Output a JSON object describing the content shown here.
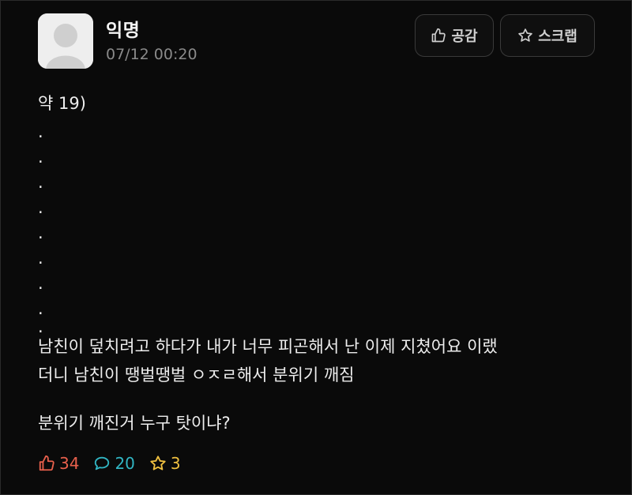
{
  "post": {
    "author": "익명",
    "timestamp": "07/12 00:20",
    "first_line": "약 19)",
    "dots": [
      ".",
      ".",
      ".",
      ".",
      ".",
      ".",
      ".",
      ".",
      "."
    ],
    "text_line_1": "남친이 덮치려고 하다가 내가 너무 피곤해서 난 이제 지쳤어요 이랬",
    "text_line_2": "더니 남친이 땡벌땡벌 ㅇㅈㄹ해서 분위기 깨짐",
    "question": "분위기 깨진거 누구 탓이냐?"
  },
  "actions": {
    "like_label": "공감",
    "scrap_label": "스크랩"
  },
  "stats": {
    "likes": "34",
    "comments": "20",
    "scraps": "3"
  },
  "colors": {
    "background": "#0a0a0a",
    "like": "#e8604c",
    "comment": "#31b6c4",
    "scrap": "#f0c040"
  },
  "icons": {
    "like": "thumbs-up-icon",
    "scrap": "star-icon",
    "comment": "speech-bubble-icon",
    "avatar": "default-user-icon"
  }
}
